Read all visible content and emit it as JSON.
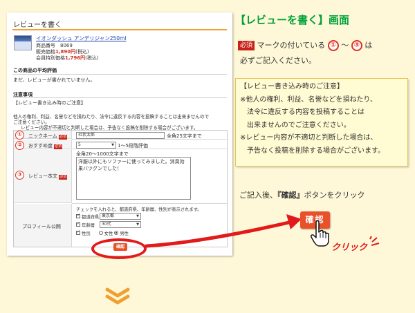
{
  "screen": {
    "title": "レビューを書く",
    "product": {
      "name": "イオンダッシュ アンデリジャン250ml",
      "code_label": "商品番号",
      "code": "8069",
      "price_label": "販売価格",
      "price": "1,890円",
      "price_tax": "(税込)",
      "member_price_label": "会員特別価格",
      "member_price": "1,796円",
      "member_price_tax": "(税込)"
    },
    "avg_section": {
      "title": "この商品の平均評価",
      "text": "まだ、レビューが書かれていません。"
    },
    "notes": {
      "title": "注意事項",
      "subtitle": "【レビュー書き込み時のご注意】",
      "line1": "他人の権利、利益、名誉などを損ねたり、法令に違反する内容を投稿することは出来ませんので",
      "line2": "ご注意ください。",
      "line3": "レビュー内容が不適切と判断した場合は、予告なく投稿を削除する場合がございます。"
    },
    "form": {
      "nickname_label": "ニックネーム",
      "nickname_value": "社状太郎",
      "nickname_hint": "全角25文字まで",
      "rating_label": "おすすめ度",
      "rating_value": "5",
      "rating_hint": "1〜5段階評価",
      "review_label": "レビュー本文",
      "review_hint": "全角20〜1000文字まで",
      "review_value": "洋服以外にもソファーに使ってみました。消臭効果バツグンでした！",
      "required_badge": "必須",
      "public_label": "プロフィール公開",
      "public_hint": "チェックを入れると、都道府県、年齢層、性別が表示されます。",
      "pref_label": "都道府県",
      "pref_value": "東京都",
      "age_label": "年齢層",
      "age_value": "30代",
      "gender_label": "性別",
      "female": "女性",
      "male": "男性"
    },
    "confirm_label": "確認",
    "markers": [
      "①",
      "②",
      "③"
    ]
  },
  "guide": {
    "heading": "【レビューを書く】画面",
    "req_mark": "必須",
    "line1_a": "マークの付いている",
    "circle1": "①",
    "tilde": "〜",
    "circle3": "③",
    "line1_b": "は",
    "line2": "必ずご記入ください。",
    "notice": [
      "【レビュー書き込み時のご注意】",
      "※他人の権利、利益、名誉などを損ねたり、",
      "　法令に違反する内容を投稿することは",
      "　出来ませんのでご注意ください。",
      "※レビュー内容が不適切と判断した場合は、",
      "　予告なく投稿を削除する場合がございます。"
    ],
    "after_a": "ご記入後、",
    "after_bold": "『確認』",
    "after_b": "ボタンをクリック",
    "confirm_button": "確認",
    "click_text": "クリック"
  },
  "colors": {
    "background": "#fff8d8",
    "heading_green": "#00a23a",
    "accent_red": "#e21a1a",
    "button_orange": "#e8512a"
  },
  "icons": [
    "hand-pointer-icon",
    "chevron-down-icon",
    "arrow-icon"
  ]
}
